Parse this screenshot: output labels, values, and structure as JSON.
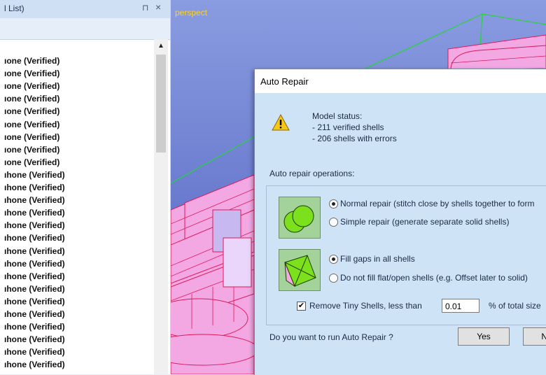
{
  "panel": {
    "title": "l List)",
    "pin_glyph": "⊓",
    "close_glyph": "×",
    "items": [
      "ıone (Verified)",
      "ıone (Verified)",
      "ıone (Verified)",
      "ıone (Verified)",
      "ıone (Verified)",
      "ıone (Verified)",
      "ıone (Verified)",
      "ıone (Verified)",
      "ıone (Verified)",
      "ıhone (Verified)",
      "ıhone (Verified)",
      "ıhone (Verified)",
      "ıhone (Verified)",
      "ıhone (Verified)",
      "ıhone (Verified)",
      "ıhone (Verified)",
      "ıhone (Verified)",
      "ıhone (Verified)",
      "ıhone (Verified)",
      "ıhone (Verified)",
      "ıhone (Verified)",
      "ıhone (Verified)",
      "ıhone (Verified)",
      "ıhone (Verified)",
      "ıhone (Verified)"
    ]
  },
  "viewport": {
    "label": "perspect"
  },
  "dialog": {
    "title": "Auto Repair",
    "status_heading": "Model status:",
    "status_line1": " - 211 verified shells",
    "status_line2": " - 206 shells with errors",
    "ops_label": "Auto repair operations:",
    "opt_normal": "Normal repair (stitch close by shells together to form",
    "opt_simple": "Simple repair (generate separate solid shells)",
    "opt_fill": "Fill gaps in all shells",
    "opt_nofill": "Do not fill flat/open shells (e.g. Offset later to solid)",
    "tiny_label": "Remove Tiny Shells, less than",
    "tiny_value": "0.01",
    "tiny_suffix": "% of total size",
    "question": "Do you want to run Auto Repair ?",
    "yes_label": "Yes",
    "no_label": "N"
  },
  "colors": {
    "viewport_bg": "#6b7fd0",
    "mesh_pink": "#f3a8e3",
    "mesh_edge": "#e0195a",
    "label_yellow": "#ffd21a",
    "dialog_bg": "#cfe3f7"
  }
}
